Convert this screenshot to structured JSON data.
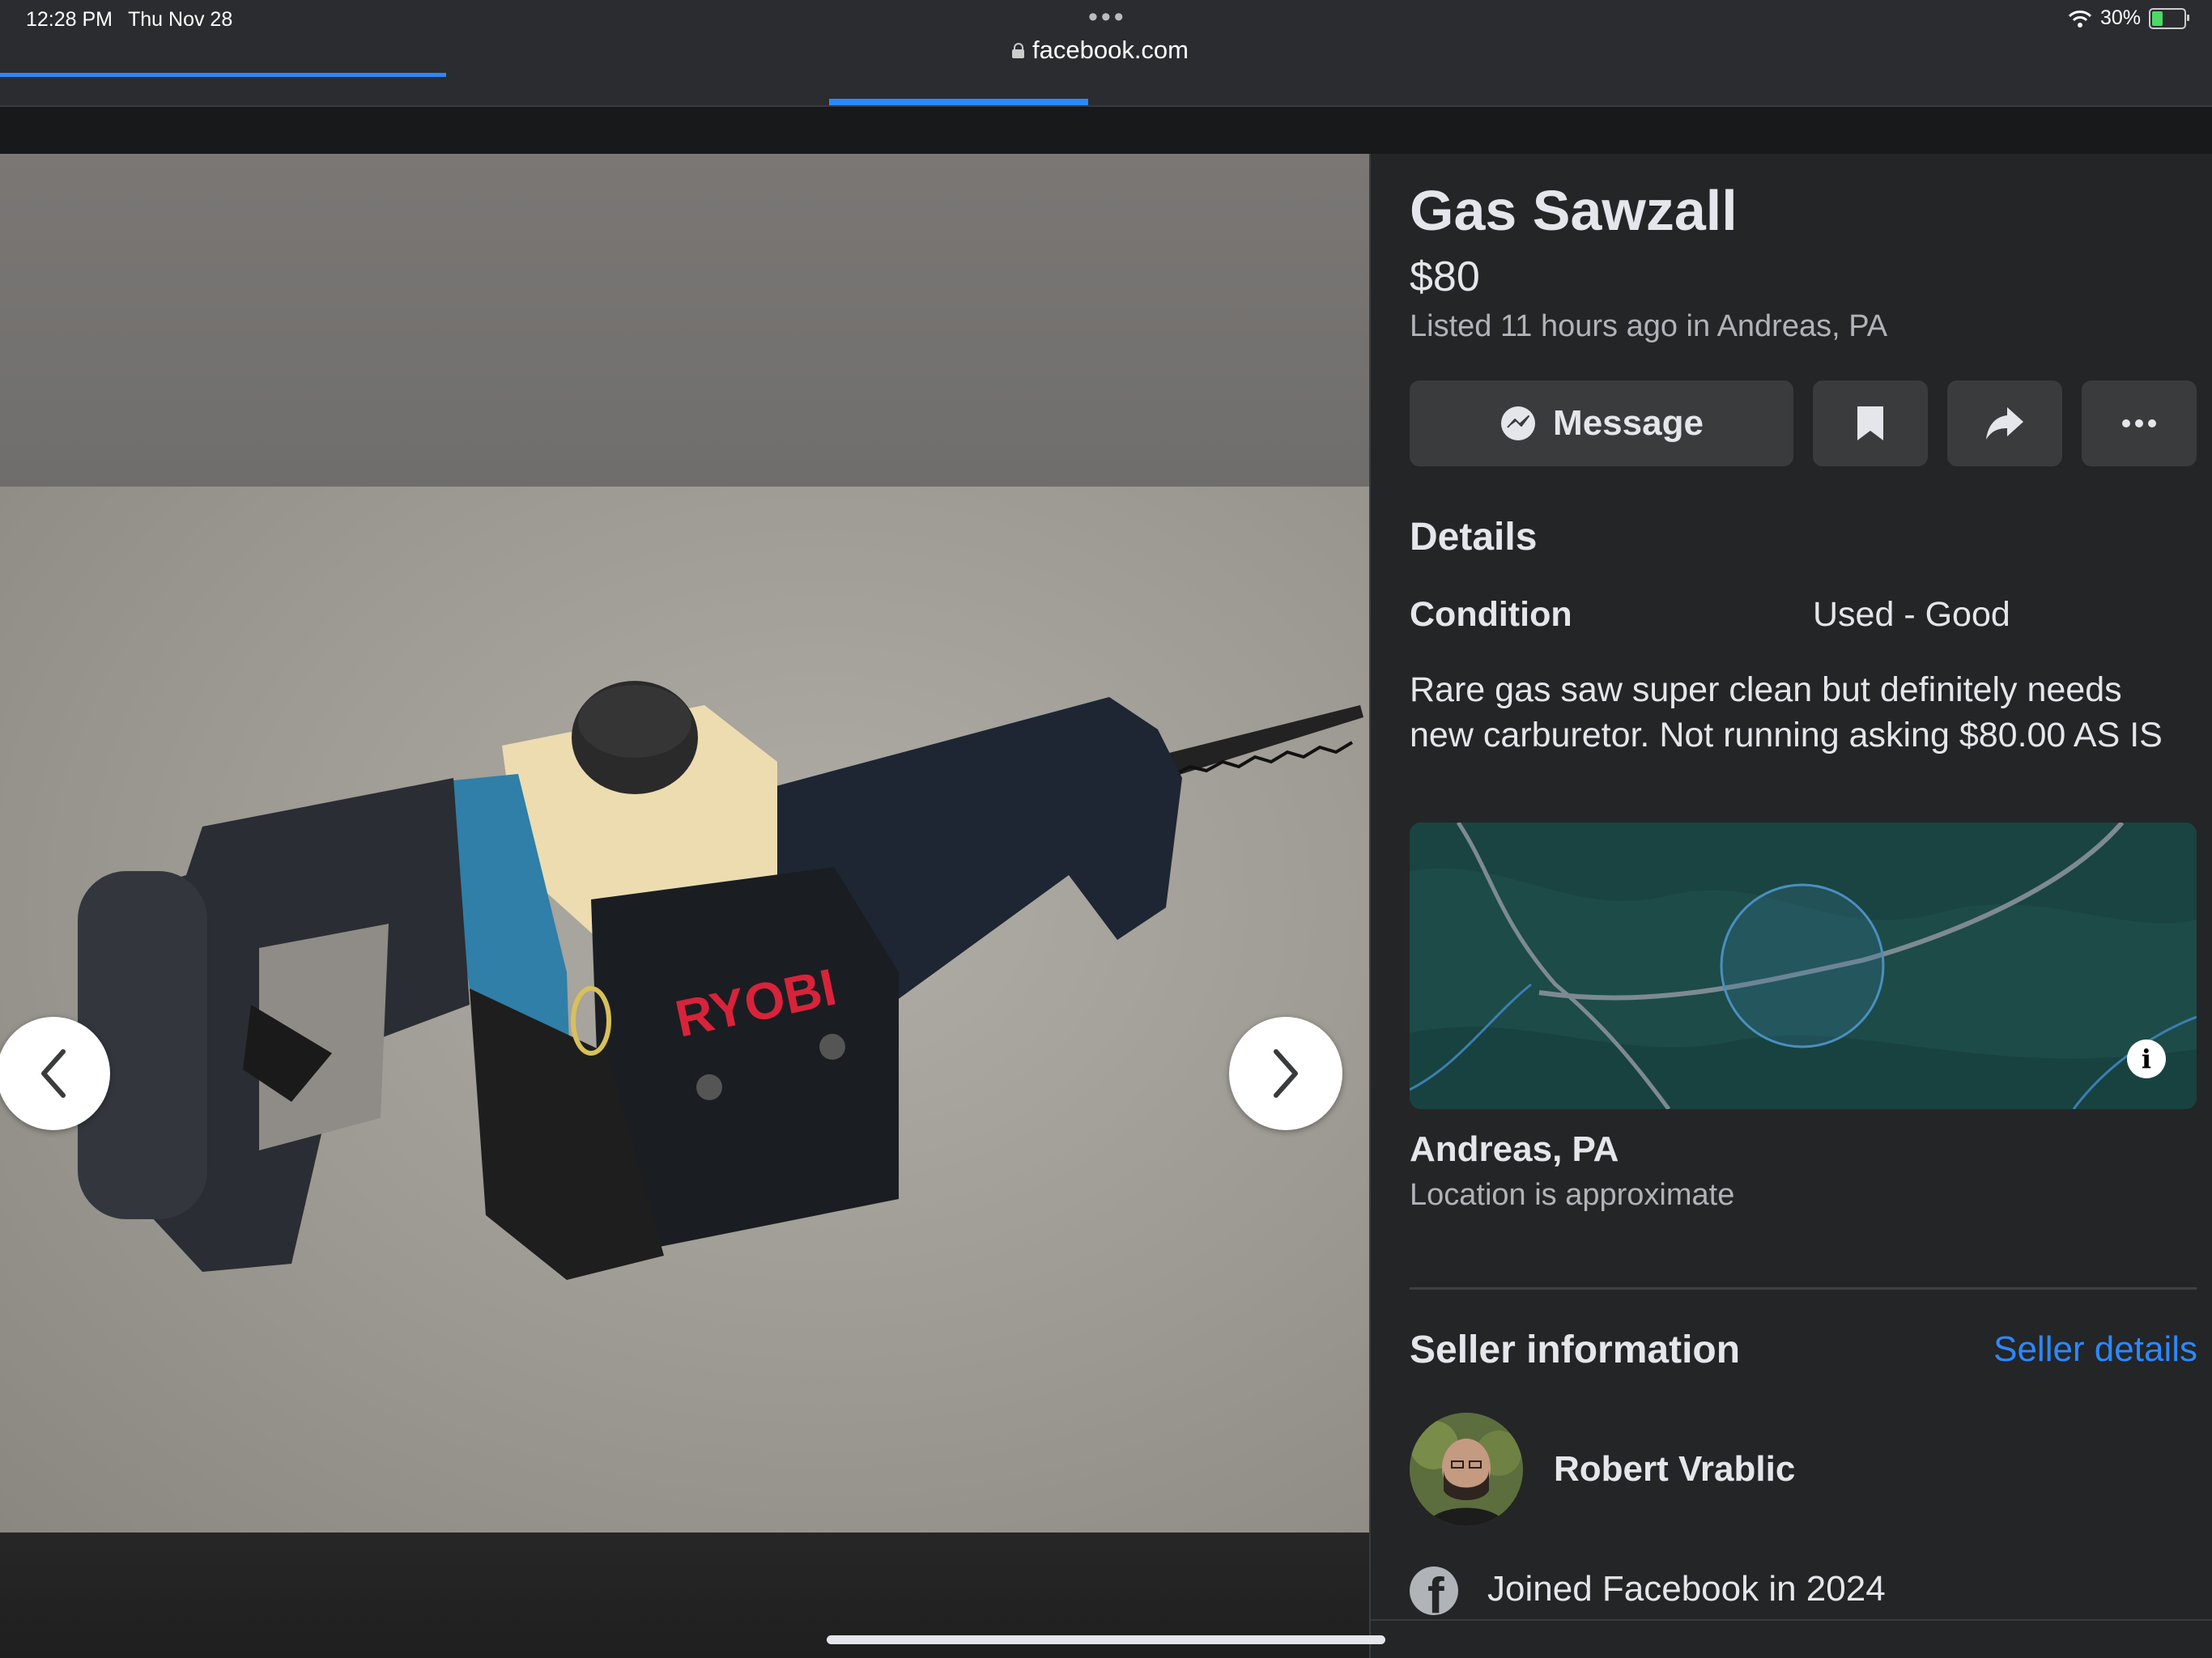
{
  "status_bar": {
    "time": "12:28 PM",
    "date": "Thu Nov 28",
    "battery": "30%"
  },
  "browser": {
    "url": "facebook.com"
  },
  "listing": {
    "title": "Gas Sawzall",
    "price": "$80",
    "listed": "Listed 11 hours ago in Andreas, PA",
    "message_label": "Message",
    "details_heading": "Details",
    "condition_label": "Condition",
    "condition_value": "Used - Good",
    "description": "Rare gas saw super clean but definitely needs new carburetor. Not running  asking $80.00 AS IS",
    "location_name": "Andreas, PA",
    "location_note": "Location is approximate"
  },
  "photo": {
    "brand_text": "RYOBI"
  },
  "seller": {
    "heading": "Seller information",
    "details_link": "Seller details",
    "name": "Robert Vrablic",
    "joined": "Joined Facebook in 2024"
  },
  "colors": {
    "accent": "#2d88ff",
    "panel_bg": "#242526",
    "button_bg": "#3a3b3c",
    "map_bg": "#1d4b48"
  },
  "icons": {
    "prev": "chevron-left-icon",
    "next": "chevron-right-icon",
    "message": "messenger-icon",
    "save": "bookmark-icon",
    "share": "share-icon",
    "more": "more-icon",
    "map_info": "info-icon",
    "facebook": "facebook-icon"
  }
}
